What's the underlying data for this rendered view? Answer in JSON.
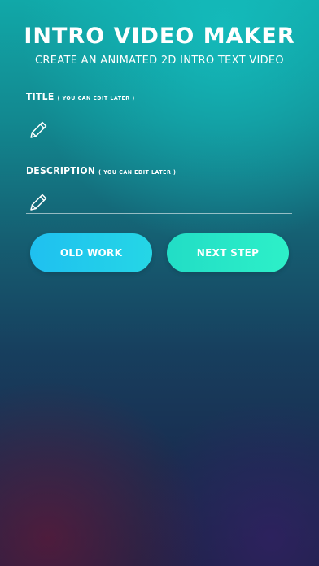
{
  "header": {
    "title": "INTRO VIDEO MAKER",
    "subtitle": "CREATE AN ANIMATED 2D INTRO TEXT VIDEO"
  },
  "form": {
    "title_field": {
      "label": "TITLE",
      "hint": "( YOU CAN EDIT LATER )",
      "value": "",
      "icon": "pencil-icon"
    },
    "description_field": {
      "label": "DESCRIPTION",
      "hint": "( YOU CAN EDIT LATER )",
      "value": "",
      "icon": "pencil-icon"
    }
  },
  "actions": {
    "old_work_label": "OLD WORK",
    "next_step_label": "NEXT STEP"
  },
  "colors": {
    "old_work_button": "#1fc0f0",
    "next_step_button": "#2df0c8",
    "text": "#ffffff"
  }
}
